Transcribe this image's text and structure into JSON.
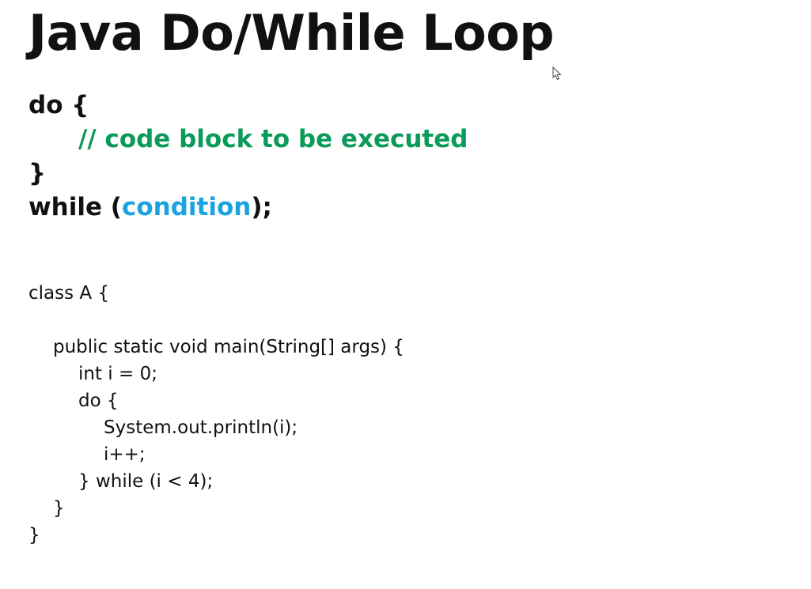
{
  "title": "Java Do/While Loop",
  "syntax": {
    "do_line": "do {",
    "comment": "// code block to be executed",
    "close_brace": "}",
    "while_prefix": "while (",
    "condition": "condition",
    "while_suffix": ");"
  },
  "example": {
    "lines": [
      "class A {",
      "",
      "public static void main(String[] args) {",
      "int i = 0;",
      "do {",
      "System.out.println(i);",
      "i++;",
      "} while (i < 4);",
      "}",
      "}"
    ]
  },
  "colors": {
    "comment": "#0a9a5a",
    "condition": "#1ba3e0",
    "text": "#111111",
    "background": "#ffffff"
  },
  "icons": {
    "cursor": "mouse-pointer-icon"
  }
}
